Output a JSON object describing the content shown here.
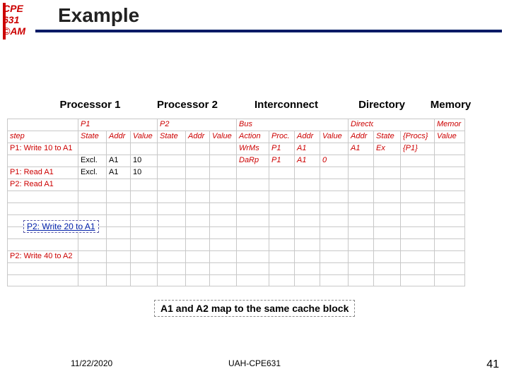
{
  "logo": {
    "l1": "CPE",
    "l2": "631",
    "l3": "©AM"
  },
  "title": "Example",
  "section_headers": {
    "h1": "Processor 1",
    "h2": "Processor 2",
    "h3": "Interconnect",
    "h4": "Directory",
    "h5": "Memory"
  },
  "top_row": {
    "step": "",
    "p1": "P1",
    "p2": "P2",
    "bus": "Bus",
    "dir": "Directory",
    "mem": "Memor"
  },
  "hdr_row": {
    "step": "step",
    "p1a": "State",
    "p1b": "Addr",
    "p1c": "Value",
    "p2a": "State",
    "p2b": "Addr",
    "p2c": "Value",
    "ba": "Action",
    "bb": "Proc.",
    "bc": "Addr",
    "bd": "Value",
    "da": "Addr",
    "db": "State",
    "dc": "{Procs}",
    "dd": "Value"
  },
  "rows": [
    {
      "step": "P1: Write 10 to A1",
      "p1a": "",
      "p1b": "",
      "p1c": "",
      "p2a": "",
      "p2b": "",
      "p2c": "",
      "ba": "WrMs",
      "bb": "P1",
      "bc": "A1",
      "bd": "",
      "da": "A1",
      "db": "Ex",
      "dc": "{P1}",
      "dd": ""
    },
    {
      "step": "",
      "p1a": "Excl.",
      "p1b": "A1",
      "p1c": "10",
      "p2a": "",
      "p2b": "",
      "p2c": "",
      "ba": "DaRp",
      "bb": "P1",
      "bc": "A1",
      "bd": "0",
      "da": "",
      "db": "",
      "dc": "",
      "dd": ""
    },
    {
      "step": "P1: Read A1",
      "p1a": "Excl.",
      "p1b": "A1",
      "p1c": "10",
      "p2a": "",
      "p2b": "",
      "p2c": "",
      "ba": "",
      "bb": "",
      "bc": "",
      "bd": "",
      "da": "",
      "db": "",
      "dc": "",
      "dd": ""
    },
    {
      "step": "P2: Read A1",
      "p1a": "",
      "p1b": "",
      "p1c": "",
      "p2a": "",
      "p2b": "",
      "p2c": "",
      "ba": "",
      "bb": "",
      "bc": "",
      "bd": "",
      "da": "",
      "db": "",
      "dc": "",
      "dd": ""
    },
    {
      "step": "",
      "p1a": "",
      "p1b": "",
      "p1c": "",
      "p2a": "",
      "p2b": "",
      "p2c": "",
      "ba": "",
      "bb": "",
      "bc": "",
      "bd": "",
      "da": "",
      "db": "",
      "dc": "",
      "dd": ""
    },
    {
      "step": "",
      "p1a": "",
      "p1b": "",
      "p1c": "",
      "p2a": "",
      "p2b": "",
      "p2c": "",
      "ba": "",
      "bb": "",
      "bc": "",
      "bd": "",
      "da": "",
      "db": "",
      "dc": "",
      "dd": ""
    },
    {
      "step": "",
      "p1a": "",
      "p1b": "",
      "p1c": "",
      "p2a": "",
      "p2b": "",
      "p2c": "",
      "ba": "",
      "bb": "",
      "bc": "",
      "bd": "",
      "da": "",
      "db": "",
      "dc": "",
      "dd": ""
    },
    {
      "step": "",
      "p1a": "",
      "p1b": "",
      "p1c": "",
      "p2a": "",
      "p2b": "",
      "p2c": "",
      "ba": "",
      "bb": "",
      "bc": "",
      "bd": "",
      "da": "",
      "db": "",
      "dc": "",
      "dd": ""
    },
    {
      "step": "",
      "p1a": "",
      "p1b": "",
      "p1c": "",
      "p2a": "",
      "p2b": "",
      "p2c": "",
      "ba": "",
      "bb": "",
      "bc": "",
      "bd": "",
      "da": "",
      "db": "",
      "dc": "",
      "dd": ""
    },
    {
      "step": "P2: Write 40 to A2",
      "p1a": "",
      "p1b": "",
      "p1c": "",
      "p2a": "",
      "p2b": "",
      "p2c": "",
      "ba": "",
      "bb": "",
      "bc": "",
      "bd": "",
      "da": "",
      "db": "",
      "dc": "",
      "dd": ""
    },
    {
      "step": "",
      "p1a": "",
      "p1b": "",
      "p1c": "",
      "p2a": "",
      "p2b": "",
      "p2c": "",
      "ba": "",
      "bb": "",
      "bc": "",
      "bd": "",
      "da": "",
      "db": "",
      "dc": "",
      "dd": ""
    },
    {
      "step": "",
      "p1a": "",
      "p1b": "",
      "p1c": "",
      "p2a": "",
      "p2b": "",
      "p2c": "",
      "ba": "",
      "bb": "",
      "bc": "",
      "bd": "",
      "da": "",
      "db": "",
      "dc": "",
      "dd": ""
    }
  ],
  "annotate": "P2: Write 20 to A1",
  "mapnote": "A1 and A2 map to the same cache block",
  "footer": {
    "date": "11/22/2020",
    "center": "UAH-CPE631",
    "page": "41"
  }
}
